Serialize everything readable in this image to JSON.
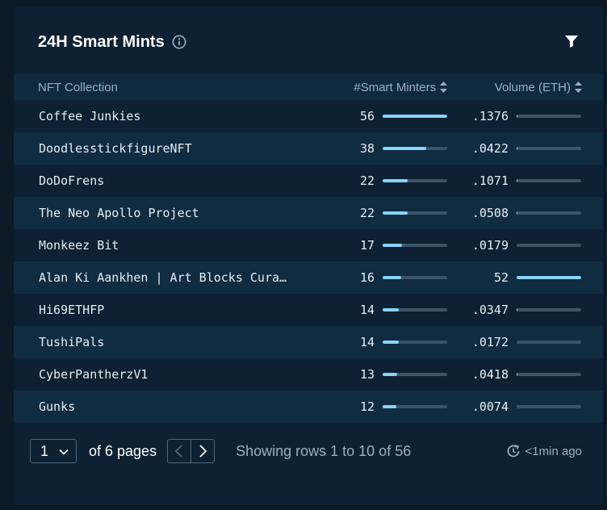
{
  "header": {
    "title": "24H Smart Mints"
  },
  "columns": {
    "collection": "NFT Collection",
    "minters": "#Smart Minters",
    "volume": "Volume (ETH)"
  },
  "rows": [
    {
      "name": "Coffee Junkies",
      "minters": "56",
      "minters_frac": 1.0,
      "volume": ".1376",
      "volume_frac": 0.003
    },
    {
      "name": "DoodlesstickfigureNFT",
      "minters": "38",
      "minters_frac": 0.68,
      "volume": ".0422",
      "volume_frac": 0.001
    },
    {
      "name": "DoDoFrens",
      "minters": "22",
      "minters_frac": 0.39,
      "volume": ".1071",
      "volume_frac": 0.002
    },
    {
      "name": "The Neo Apollo Project",
      "minters": "22",
      "minters_frac": 0.39,
      "volume": ".0508",
      "volume_frac": 0.001
    },
    {
      "name": "Monkeez Bit",
      "minters": "17",
      "minters_frac": 0.3,
      "volume": ".0179",
      "volume_frac": 0.0
    },
    {
      "name": "Alan Ki Aankhen | Art Blocks Curated",
      "minters": "16",
      "minters_frac": 0.29,
      "volume": "52",
      "volume_frac": 1.0
    },
    {
      "name": "Hi69ETHFP",
      "minters": "14",
      "minters_frac": 0.25,
      "volume": ".0347",
      "volume_frac": 0.001
    },
    {
      "name": "TushiPals",
      "minters": "14",
      "minters_frac": 0.25,
      "volume": ".0172",
      "volume_frac": 0.0
    },
    {
      "name": "CyberPantherzV1",
      "minters": "13",
      "minters_frac": 0.23,
      "volume": ".0418",
      "volume_frac": 0.001
    },
    {
      "name": "Gunks",
      "minters": "12",
      "minters_frac": 0.21,
      "volume": ".0074",
      "volume_frac": 0.0
    }
  ],
  "pagination": {
    "current_page": "1",
    "of_pages": "of 6 pages",
    "showing": "Showing rows 1 to 10 of 56",
    "updated": "<1min ago"
  },
  "icons": {
    "info": "info-icon",
    "filter": "filter-icon",
    "sort": "sort-icon",
    "refresh": "refresh-clock-icon"
  },
  "colors": {
    "bar_fill": "#88d4fb",
    "bar_track": "#3c5468",
    "background": "#0d2132"
  }
}
